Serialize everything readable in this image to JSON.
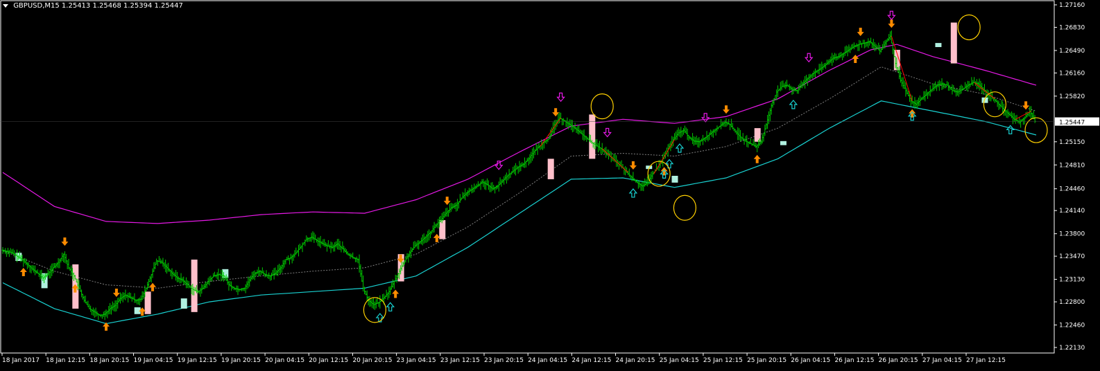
{
  "header": {
    "symbol": "GBPUSD,M15",
    "ohlc": "1.25413 1.25468 1.25394 1.25447"
  },
  "colors": {
    "background": "#000000",
    "frame": "#ffffff",
    "bull_bar": "#00cc00",
    "bear_bar": "#00cc00",
    "upper_band": "#e619e6",
    "lower_band": "#19d2d2",
    "mid_band": "#808080",
    "signal_up": "#ff8c00",
    "signal_down": "#ff8c00",
    "hollow_up": "#19d2d2",
    "hollow_down": "#e619e6",
    "highlight_pink": "#ffc0cb",
    "highlight_cyan": "#b0f0e0",
    "circle": "#ffd000",
    "trend_red": "#ff0000",
    "price_label_bg": "#ffffff",
    "price_label_text": "#000000"
  },
  "chart_data": {
    "type": "candlestick",
    "instrument": "GBPUSD",
    "timeframe": "M15",
    "current_price": "1.25447",
    "y_ticks": [
      "1.27160",
      "1.26830",
      "1.26490",
      "1.26160",
      "1.25820",
      "1.25150",
      "1.24810",
      "1.24460",
      "1.24140",
      "1.23800",
      "1.23470",
      "1.23130",
      "1.22800",
      "1.22460",
      "1.22130"
    ],
    "ylim": [
      1.2213,
      1.2716
    ],
    "x_ticks": [
      "18 Jan 2017",
      "18 Jan 12:15",
      "18 Jan 20:15",
      "19 Jan 04:15",
      "19 Jan 12:15",
      "19 Jan 20:15",
      "20 Jan 04:15",
      "20 Jan 12:15",
      "20 Jan 20:15",
      "23 Jan 04:15",
      "23 Jan 12:15",
      "23 Jan 20:15",
      "24 Jan 04:15",
      "24 Jan 12:15",
      "24 Jan 20:15",
      "25 Jan 04:15",
      "25 Jan 12:15",
      "25 Jan 20:15",
      "26 Jan 04:15",
      "26 Jan 12:15",
      "26 Jan 20:15",
      "27 Jan 04:15",
      "27 Jan 12:15"
    ],
    "price_path": [
      [
        0,
        1.2356
      ],
      [
        2,
        1.2352
      ],
      [
        4,
        1.2342
      ],
      [
        6,
        1.2328
      ],
      [
        7,
        1.2322
      ],
      [
        8,
        1.2315
      ],
      [
        9,
        1.2321
      ],
      [
        10,
        1.233
      ],
      [
        11,
        1.2338
      ],
      [
        12,
        1.235
      ],
      [
        13,
        1.233
      ],
      [
        14,
        1.2318
      ],
      [
        15,
        1.23
      ],
      [
        16,
        1.2282
      ],
      [
        17,
        1.227
      ],
      [
        18,
        1.2265
      ],
      [
        19,
        1.226
      ],
      [
        20,
        1.2262
      ],
      [
        21,
        1.227
      ],
      [
        22,
        1.2275
      ],
      [
        23,
        1.2285
      ],
      [
        24,
        1.229
      ],
      [
        25,
        1.2286
      ],
      [
        26,
        1.2282
      ],
      [
        27,
        1.2284
      ],
      [
        28,
        1.23
      ],
      [
        29,
        1.232
      ],
      [
        30,
        1.234
      ],
      [
        31,
        1.2338
      ],
      [
        32,
        1.233
      ],
      [
        33,
        1.2322
      ],
      [
        34,
        1.2315
      ],
      [
        35,
        1.2312
      ],
      [
        36,
        1.2305
      ],
      [
        37,
        1.2298
      ],
      [
        38,
        1.2295
      ],
      [
        39,
        1.23
      ],
      [
        40,
        1.231
      ],
      [
        41,
        1.2318
      ],
      [
        42,
        1.232
      ],
      [
        43,
        1.2318
      ],
      [
        44,
        1.2305
      ],
      [
        45,
        1.23
      ],
      [
        46,
        1.2298
      ],
      [
        47,
        1.23
      ],
      [
        48,
        1.2312
      ],
      [
        49,
        1.2322
      ],
      [
        50,
        1.2325
      ],
      [
        51,
        1.232
      ],
      [
        52,
        1.2318
      ],
      [
        53,
        1.2322
      ],
      [
        54,
        1.233
      ],
      [
        55,
        1.2342
      ],
      [
        56,
        1.2345
      ],
      [
        57,
        1.2352
      ],
      [
        58,
        1.2362
      ],
      [
        59,
        1.2372
      ],
      [
        60,
        1.2375
      ],
      [
        61,
        1.237
      ],
      [
        62,
        1.2366
      ],
      [
        63,
        1.2362
      ],
      [
        64,
        1.236
      ],
      [
        65,
        1.2365
      ],
      [
        66,
        1.2358
      ],
      [
        67,
        1.235
      ],
      [
        68,
        1.2345
      ],
      [
        69,
        1.2342
      ],
      [
        70,
        1.23
      ],
      [
        71,
        1.2282
      ],
      [
        72,
        1.2276
      ],
      [
        73,
        1.2279
      ],
      [
        74,
        1.2286
      ],
      [
        75,
        1.2295
      ],
      [
        76,
        1.231
      ],
      [
        77,
        1.2325
      ],
      [
        78,
        1.234
      ],
      [
        79,
        1.2352
      ],
      [
        80,
        1.2362
      ],
      [
        81,
        1.2368
      ],
      [
        82,
        1.2375
      ],
      [
        83,
        1.2382
      ],
      [
        84,
        1.2392
      ],
      [
        85,
        1.24
      ],
      [
        86,
        1.241
      ],
      [
        87,
        1.2418
      ],
      [
        88,
        1.2422
      ],
      [
        89,
        1.2432
      ],
      [
        90,
        1.244
      ],
      [
        91,
        1.2445
      ],
      [
        92,
        1.245
      ],
      [
        93,
        1.2456
      ],
      [
        94,
        1.2452
      ],
      [
        95,
        1.2446
      ],
      [
        96,
        1.245
      ],
      [
        97,
        1.2458
      ],
      [
        98,
        1.2466
      ],
      [
        99,
        1.2472
      ],
      [
        100,
        1.2478
      ],
      [
        101,
        1.2482
      ],
      [
        102,
        1.249
      ],
      [
        103,
        1.25
      ],
      [
        104,
        1.2508
      ],
      [
        105,
        1.2515
      ],
      [
        106,
        1.252
      ],
      [
        107,
        1.254
      ],
      [
        108,
        1.255
      ],
      [
        109,
        1.2545
      ],
      [
        110,
        1.254
      ],
      [
        111,
        1.2535
      ],
      [
        112,
        1.2528
      ],
      [
        113,
        1.2522
      ],
      [
        114,
        1.2515
      ],
      [
        115,
        1.251
      ],
      [
        116,
        1.2505
      ],
      [
        117,
        1.2498
      ],
      [
        118,
        1.2492
      ],
      [
        119,
        1.2485
      ],
      [
        120,
        1.2478
      ],
      [
        121,
        1.247
      ],
      [
        122,
        1.2462
      ],
      [
        123,
        1.2455
      ],
      [
        124,
        1.245
      ],
      [
        125,
        1.2455
      ],
      [
        126,
        1.2468
      ],
      [
        127,
        1.2478
      ],
      [
        128,
        1.249
      ],
      [
        129,
        1.2505
      ],
      [
        130,
        1.2518
      ],
      [
        131,
        1.2528
      ],
      [
        132,
        1.2532
      ],
      [
        133,
        1.2522
      ],
      [
        134,
        1.2516
      ],
      [
        135,
        1.2515
      ],
      [
        136,
        1.252
      ],
      [
        137,
        1.2526
      ],
      [
        138,
        1.2532
      ],
      [
        139,
        1.2538
      ],
      [
        140,
        1.2544
      ],
      [
        141,
        1.254
      ],
      [
        142,
        1.253
      ],
      [
        143,
        1.2522
      ],
      [
        144,
        1.2516
      ],
      [
        145,
        1.2512
      ],
      [
        146,
        1.2508
      ],
      [
        147,
        1.2515
      ],
      [
        148,
        1.254
      ],
      [
        149,
        1.2568
      ],
      [
        150,
        1.2588
      ],
      [
        151,
        1.2596
      ],
      [
        152,
        1.2598
      ],
      [
        153,
        1.2592
      ],
      [
        154,
        1.259
      ],
      [
        155,
        1.26
      ],
      [
        156,
        1.2608
      ],
      [
        157,
        1.2615
      ],
      [
        158,
        1.262
      ],
      [
        159,
        1.2625
      ],
      [
        160,
        1.2632
      ],
      [
        161,
        1.2638
      ],
      [
        162,
        1.264
      ],
      [
        163,
        1.2645
      ],
      [
        164,
        1.265
      ],
      [
        165,
        1.2655
      ],
      [
        166,
        1.2658
      ],
      [
        167,
        1.266
      ],
      [
        168,
        1.2662
      ],
      [
        169,
        1.2655
      ],
      [
        170,
        1.2648
      ],
      [
        171,
        1.266
      ],
      [
        172,
        1.267
      ],
      [
        173,
        1.263
      ],
      [
        174,
        1.2605
      ],
      [
        175,
        1.259
      ],
      [
        176,
        1.2575
      ],
      [
        177,
        1.257
      ],
      [
        178,
        1.2578
      ],
      [
        179,
        1.2585
      ],
      [
        180,
        1.2592
      ],
      [
        181,
        1.2598
      ],
      [
        182,
        1.26
      ],
      [
        183,
        1.2598
      ],
      [
        184,
        1.259
      ],
      [
        185,
        1.2588
      ],
      [
        186,
        1.2592
      ],
      [
        187,
        1.2598
      ],
      [
        188,
        1.2602
      ],
      [
        189,
        1.26
      ],
      [
        190,
        1.2592
      ],
      [
        191,
        1.2585
      ],
      [
        192,
        1.2578
      ],
      [
        193,
        1.257
      ],
      [
        194,
        1.2562
      ],
      [
        195,
        1.2555
      ],
      [
        196,
        1.2548
      ],
      [
        197,
        1.2544
      ],
      [
        198,
        1.255
      ],
      [
        199,
        1.256
      ],
      [
        200,
        1.2545
      ]
    ],
    "upper_band": [
      [
        0,
        1.247
      ],
      [
        10,
        1.242
      ],
      [
        20,
        1.2398
      ],
      [
        30,
        1.2395
      ],
      [
        40,
        1.24
      ],
      [
        50,
        1.2408
      ],
      [
        60,
        1.2412
      ],
      [
        70,
        1.241
      ],
      [
        80,
        1.243
      ],
      [
        90,
        1.246
      ],
      [
        100,
        1.25
      ],
      [
        110,
        1.2538
      ],
      [
        120,
        1.2548
      ],
      [
        130,
        1.2542
      ],
      [
        140,
        1.2552
      ],
      [
        150,
        1.2578
      ],
      [
        160,
        1.262
      ],
      [
        168,
        1.265
      ],
      [
        173,
        1.2658
      ],
      [
        180,
        1.264
      ],
      [
        190,
        1.262
      ],
      [
        200,
        1.2598
      ]
    ],
    "mid_band": [
      [
        0,
        1.2355
      ],
      [
        10,
        1.2325
      ],
      [
        20,
        1.2305
      ],
      [
        30,
        1.23
      ],
      [
        40,
        1.231
      ],
      [
        50,
        1.2318
      ],
      [
        60,
        1.2325
      ],
      [
        70,
        1.233
      ],
      [
        80,
        1.235
      ],
      [
        90,
        1.239
      ],
      [
        100,
        1.244
      ],
      [
        110,
        1.2494
      ],
      [
        120,
        1.2498
      ],
      [
        130,
        1.2494
      ],
      [
        140,
        1.2508
      ],
      [
        150,
        1.2535
      ],
      [
        160,
        1.2578
      ],
      [
        170,
        1.2625
      ],
      [
        180,
        1.26
      ],
      [
        190,
        1.2585
      ],
      [
        200,
        1.256
      ]
    ],
    "lower_band": [
      [
        0,
        1.2308
      ],
      [
        10,
        1.227
      ],
      [
        20,
        1.2248
      ],
      [
        30,
        1.2262
      ],
      [
        40,
        1.228
      ],
      [
        50,
        1.229
      ],
      [
        60,
        1.2295
      ],
      [
        70,
        1.23
      ],
      [
        80,
        1.2318
      ],
      [
        90,
        1.236
      ],
      [
        100,
        1.241
      ],
      [
        110,
        1.246
      ],
      [
        120,
        1.2462
      ],
      [
        130,
        1.2448
      ],
      [
        140,
        1.2462
      ],
      [
        150,
        1.249
      ],
      [
        160,
        1.2535
      ],
      [
        170,
        1.2575
      ],
      [
        180,
        1.256
      ],
      [
        190,
        1.2545
      ],
      [
        200,
        1.2525
      ]
    ],
    "signals": [
      {
        "i": 4,
        "dir": "up"
      },
      {
        "i": 12,
        "dir": "down"
      },
      {
        "i": 14,
        "dir": "up"
      },
      {
        "i": 20,
        "dir": "up"
      },
      {
        "i": 22,
        "dir": "down"
      },
      {
        "i": 27,
        "dir": "up"
      },
      {
        "i": 29,
        "dir": "up"
      },
      {
        "i": 76,
        "dir": "up"
      },
      {
        "i": 77,
        "dir": "down"
      },
      {
        "i": 84,
        "dir": "up"
      },
      {
        "i": 86,
        "dir": "down"
      },
      {
        "i": 107,
        "dir": "down"
      },
      {
        "i": 122,
        "dir": "down"
      },
      {
        "i": 128,
        "dir": "up"
      },
      {
        "i": 140,
        "dir": "down"
      },
      {
        "i": 146,
        "dir": "up"
      },
      {
        "i": 165,
        "dir": "up"
      },
      {
        "i": 166,
        "dir": "down"
      },
      {
        "i": 172,
        "dir": "down"
      },
      {
        "i": 176,
        "dir": "up"
      },
      {
        "i": 198,
        "dir": "down"
      }
    ],
    "hollow_arrows": [
      {
        "i": 73,
        "dir": "up"
      },
      {
        "i": 75,
        "dir": "up"
      },
      {
        "i": 96,
        "dir": "down"
      },
      {
        "i": 108,
        "dir": "down"
      },
      {
        "i": 117,
        "dir": "down"
      },
      {
        "i": 122,
        "dir": "up"
      },
      {
        "i": 128,
        "dir": "up"
      },
      {
        "i": 129,
        "dir": "up"
      },
      {
        "i": 131,
        "dir": "up"
      },
      {
        "i": 136,
        "dir": "down"
      },
      {
        "i": 153,
        "dir": "up"
      },
      {
        "i": 156,
        "dir": "down"
      },
      {
        "i": 172,
        "dir": "down"
      },
      {
        "i": 176,
        "dir": "up"
      },
      {
        "i": 195,
        "dir": "up"
      }
    ],
    "highlight_boxes": [
      {
        "i": 3,
        "lo": 1.234,
        "hi": 1.2352,
        "color": "cyan"
      },
      {
        "i": 8,
        "lo": 1.23,
        "hi": 1.2322,
        "color": "cyan"
      },
      {
        "i": 14,
        "lo": 1.227,
        "hi": 1.2335,
        "color": "pink"
      },
      {
        "i": 26,
        "lo": 1.2262,
        "hi": 1.2272,
        "color": "cyan"
      },
      {
        "i": 28,
        "lo": 1.2262,
        "hi": 1.2295,
        "color": "pink"
      },
      {
        "i": 35,
        "lo": 1.227,
        "hi": 1.2285,
        "color": "cyan"
      },
      {
        "i": 37,
        "lo": 1.2265,
        "hi": 1.2342,
        "color": "pink"
      },
      {
        "i": 43,
        "lo": 1.2315,
        "hi": 1.2328,
        "color": "cyan"
      },
      {
        "i": 77,
        "lo": 1.231,
        "hi": 1.235,
        "color": "pink"
      },
      {
        "i": 85,
        "lo": 1.2372,
        "hi": 1.24,
        "color": "pink"
      },
      {
        "i": 106,
        "lo": 1.246,
        "hi": 1.249,
        "color": "pink"
      },
      {
        "i": 114,
        "lo": 1.249,
        "hi": 1.2555,
        "color": "pink"
      },
      {
        "i": 125,
        "lo": 1.2475,
        "hi": 1.248,
        "color": "cyan"
      },
      {
        "i": 130,
        "lo": 1.2455,
        "hi": 1.2465,
        "color": "cyan"
      },
      {
        "i": 146,
        "lo": 1.2515,
        "hi": 1.2535,
        "color": "pink"
      },
      {
        "i": 151,
        "lo": 1.251,
        "hi": 1.2516,
        "color": "cyan"
      },
      {
        "i": 173,
        "lo": 1.262,
        "hi": 1.265,
        "color": "pink"
      },
      {
        "i": 184,
        "lo": 1.263,
        "hi": 1.269,
        "color": "pink"
      },
      {
        "i": 181,
        "lo": 1.2654,
        "hi": 1.266,
        "color": "cyan"
      },
      {
        "i": 190,
        "lo": 1.2572,
        "hi": 1.258,
        "color": "cyan"
      }
    ],
    "circles": [
      {
        "i": 72,
        "p": 1.2268
      },
      {
        "i": 116,
        "p": 1.2567
      },
      {
        "i": 127,
        "p": 1.2468
      },
      {
        "i": 132,
        "p": 1.2418
      },
      {
        "i": 187,
        "p": 1.2683
      },
      {
        "i": 192,
        "p": 1.257
      },
      {
        "i": 216,
        "p": 1.2532
      }
    ]
  }
}
